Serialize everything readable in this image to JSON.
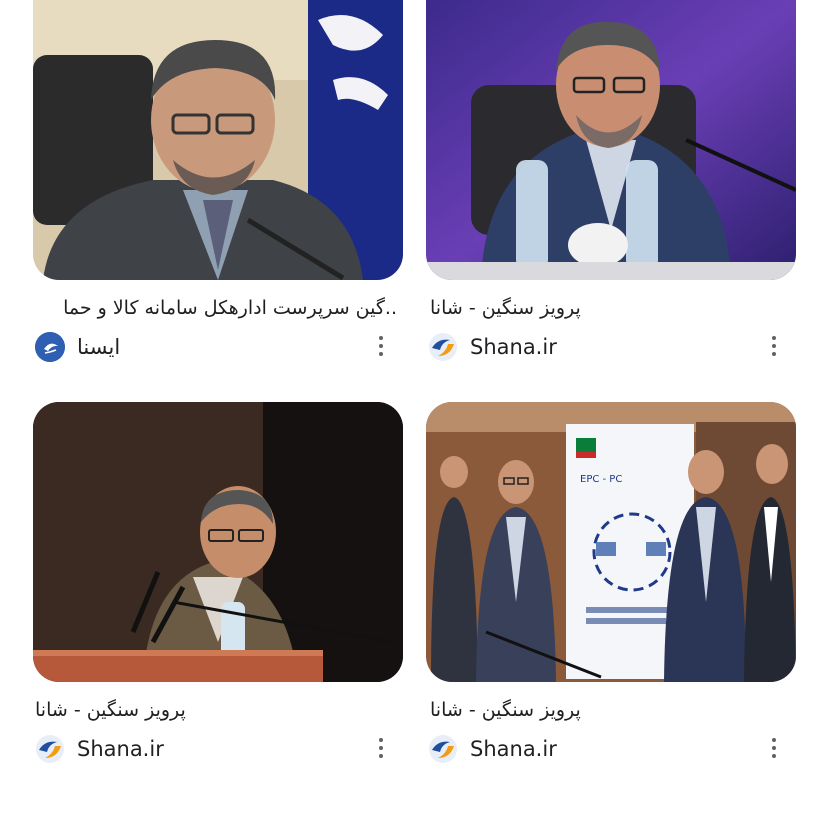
{
  "results": [
    {
      "title": "..گین سرپرست ادارهکل سامانه کالا و حما",
      "source": "ایسنا",
      "favicon_icon": "isna-logo-icon"
    },
    {
      "title": "پرویز سنگین - شانا",
      "source": "Shana.ir",
      "favicon_icon": "shana-logo-icon"
    },
    {
      "title": "پرویز سنگین - شانا",
      "source": "Shana.ir",
      "favicon_icon": "shana-logo-icon"
    },
    {
      "title": "پرویز سنگین - شانا",
      "source": "Shana.ir",
      "favicon_icon": "shana-logo-icon"
    }
  ],
  "colors": {
    "isna_blue": "#2f5fb3",
    "shana_blue": "#1f4f9e",
    "shana_orange": "#f39c12",
    "more_dots": "#5f6368"
  },
  "poster_text": "EPC - PC"
}
